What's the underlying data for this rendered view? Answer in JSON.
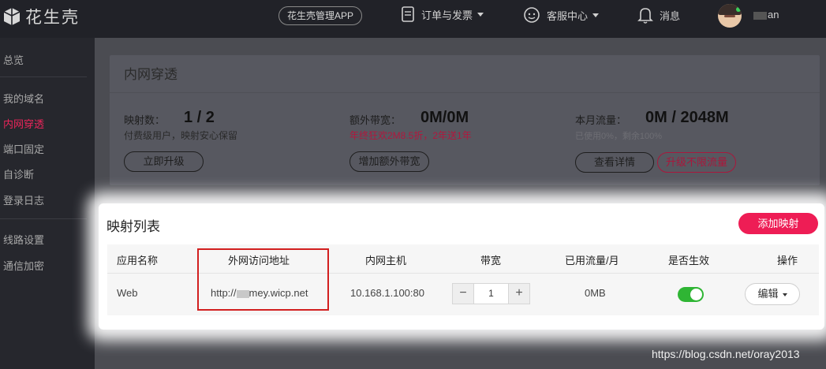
{
  "header": {
    "logo_text": "花生壳",
    "app_button": "花生壳管理APP",
    "nav": [
      {
        "label": "订单与发票",
        "icon": "document-icon"
      },
      {
        "label": "客服中心",
        "icon": "headset-icon"
      },
      {
        "label": "消息",
        "icon": "bell-icon"
      }
    ],
    "username": "an"
  },
  "sidebar": {
    "items": [
      {
        "label": "总览",
        "active": false
      },
      {
        "label": "我的域名",
        "active": false
      },
      {
        "label": "内网穿透",
        "active": true
      },
      {
        "label": "端口固定",
        "active": false
      },
      {
        "label": "自诊断",
        "active": false
      },
      {
        "label": "登录日志",
        "active": false
      },
      {
        "label": "线路设置",
        "active": false
      },
      {
        "label": "通信加密",
        "active": false
      }
    ]
  },
  "overview": {
    "title": "内网穿透",
    "mappings": {
      "label": "映射数：",
      "value": "1 / 2",
      "sub": "付费级用户，映射安心保留",
      "button": "立即升级"
    },
    "bandwidth": {
      "label": "额外带宽：",
      "value": "0M/0M",
      "sub": "年终狂欢2M8.5折，2年送1年",
      "button": "增加额外带宽"
    },
    "traffic": {
      "label": "本月流量：",
      "value": "0M / 2048M",
      "sub": "已使用0%，剩余100%",
      "button_details": "查看详情",
      "button_upgrade": "升级不限流量"
    }
  },
  "mapping_list": {
    "title": "映射列表",
    "add_button": "添加映射",
    "columns": [
      "应用名称",
      "外网访问地址",
      "内网主机",
      "带宽",
      "已用流量/月",
      "是否生效",
      "操作"
    ],
    "rows": [
      {
        "app_name": "Web",
        "url_prefix": "http://",
        "url_suffix": "mey.wicp.net",
        "host": "10.168.1.100:80",
        "bandwidth": "1",
        "used": "0MB",
        "enabled": true,
        "action": "编辑"
      }
    ]
  },
  "stepper": {
    "minus": "−",
    "plus": "+"
  },
  "watermark": "https://blog.csdn.net/oray2013",
  "colors": {
    "accent": "#ee1d55",
    "toggle_on": "#2fb534",
    "highlight": "#d21f1f"
  }
}
